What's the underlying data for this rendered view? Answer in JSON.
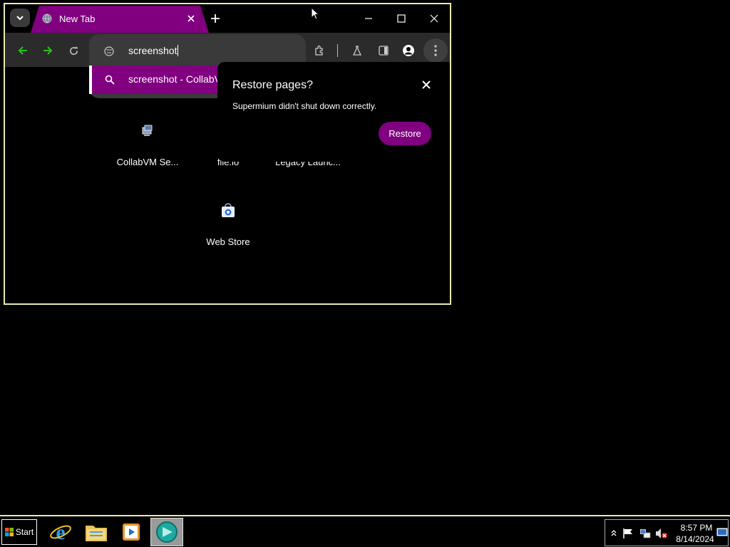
{
  "browser": {
    "tab": {
      "title": "New Tab",
      "favicon": "globe-icon"
    },
    "window_controls": [
      "minimize-icon",
      "maximize-icon",
      "close-icon"
    ],
    "omnibox": {
      "value": "screenshot",
      "icon": "site-info-icon"
    },
    "suggestion": {
      "text": "screenshot - CollabVM",
      "icon": "search-icon"
    },
    "toolbar_icons": [
      "back-icon",
      "forward-icon",
      "reload-icon",
      "extensions-icon",
      "labs-icon",
      "side-panel-icon",
      "profile-icon",
      "menu-icon"
    ],
    "accent_color": "#800080"
  },
  "restore_bubble": {
    "title": "Restore pages?",
    "message": "Supermium didn't shut down correctly.",
    "button": "Restore"
  },
  "shortcuts": [
    {
      "label": "CollabVM Se...",
      "icon": "collabvm-icon"
    },
    {
      "label": "file.io",
      "icon": ""
    },
    {
      "label": "Legacy Launc...",
      "icon": ""
    },
    {
      "label": "Web Store",
      "icon": "web-store-icon"
    }
  ],
  "taskbar": {
    "start_label": "Start",
    "apps": [
      "internet-explorer-icon",
      "file-explorer-icon",
      "media-player-icon",
      "supermium-icon"
    ],
    "tray_icons": [
      "show-hidden-icon",
      "action-center-flag-icon",
      "network-icon",
      "volume-muted-icon"
    ],
    "clock_time": "8:57 PM",
    "clock_date": "8/14/2024"
  }
}
